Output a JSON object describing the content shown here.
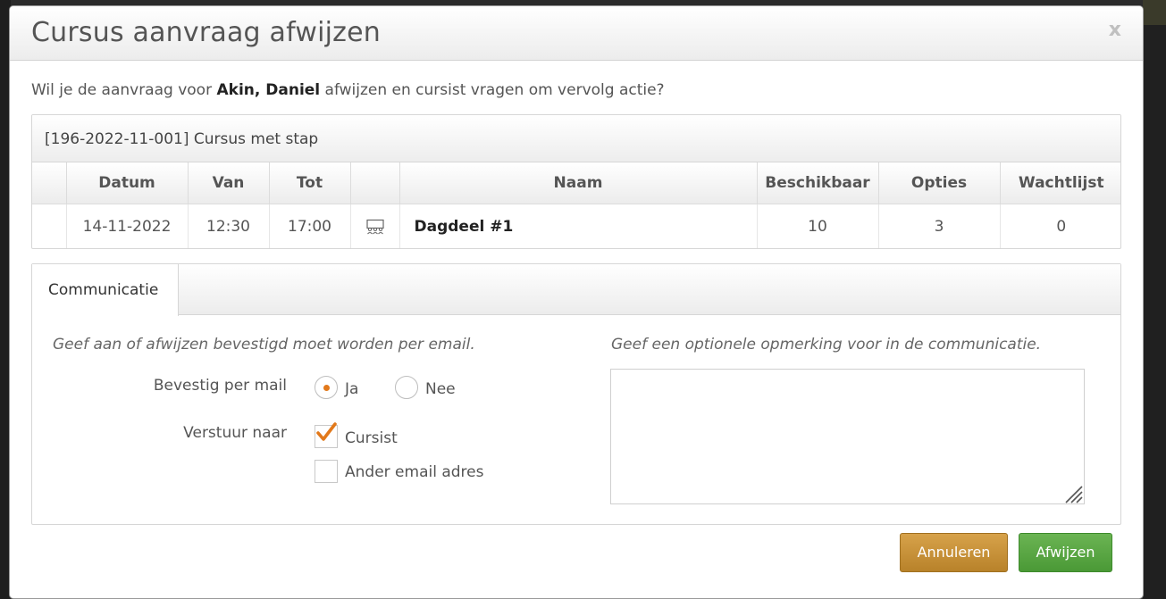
{
  "modal": {
    "title": "Cursus aanvraag afwijzen",
    "close": "x"
  },
  "intro": {
    "before": "Wil je de aanvraag voor ",
    "name": "Akin, Daniel",
    "after": " afwijzen en cursist vragen om vervolg actie?"
  },
  "course": {
    "heading": "[196-2022-11-001] Cursus met stap",
    "columns": [
      "",
      "Datum",
      "Van",
      "Tot",
      "",
      "Naam",
      "Beschikbaar",
      "Opties",
      "Wachtlijst"
    ],
    "rows": [
      {
        "datum": "14-11-2022",
        "van": "12:30",
        "tot": "17:00",
        "icon": "people-group-icon",
        "naam": "Dagdeel #1",
        "beschikbaar": "10",
        "opties": "3",
        "wachtlijst": "0"
      }
    ]
  },
  "communication": {
    "tab_label": "Communicatie",
    "left_hint": "Geef aan of afwijzen bevestigd moet worden per email.",
    "right_hint": "Geef een optionele opmerking voor in de communicatie.",
    "confirm_label": "Bevestig per mail",
    "confirm_options": [
      {
        "label": "Ja",
        "checked": true
      },
      {
        "label": "Nee",
        "checked": false
      }
    ],
    "send_to_label": "Verstuur naar",
    "send_to_options": [
      {
        "label": "Cursist",
        "checked": true
      },
      {
        "label": "Ander email adres",
        "checked": false
      }
    ],
    "remark_value": ""
  },
  "buttons": {
    "cancel": "Annuleren",
    "reject": "Afwijzen"
  },
  "colors": {
    "accent_orange": "#e2791b",
    "cancel_button": "#c8922f",
    "reject_button": "#5aa843"
  }
}
